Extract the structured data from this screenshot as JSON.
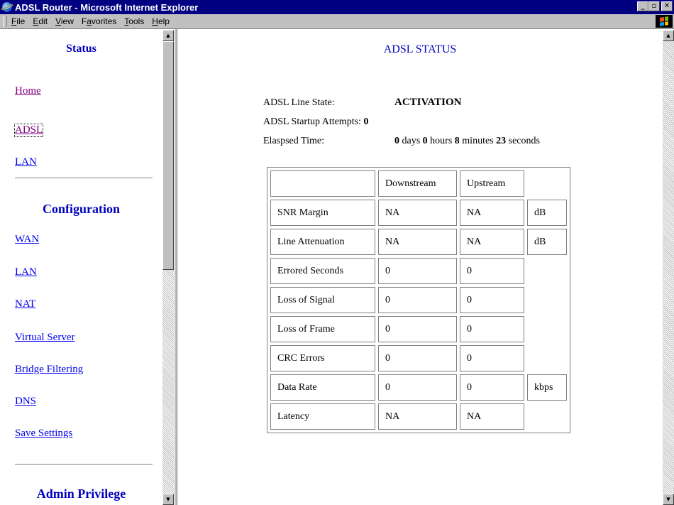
{
  "window": {
    "title": "ADSL Router - Microsoft Internet Explorer",
    "controls": [
      "_",
      "▫",
      "✕"
    ]
  },
  "menu": {
    "items": [
      {
        "label": "File",
        "key": "F"
      },
      {
        "label": "Edit",
        "key": "E"
      },
      {
        "label": "View",
        "key": "V"
      },
      {
        "label": "Favorites",
        "key": "a"
      },
      {
        "label": "Tools",
        "key": "T"
      },
      {
        "label": "Help",
        "key": "H"
      }
    ],
    "throbber_icon": "windows-logo-icon"
  },
  "sidebar": {
    "status_heading": "Status",
    "status_links": [
      "Home",
      "ADSL",
      "LAN"
    ],
    "config_heading": "Configuration",
    "config_links": [
      "WAN",
      "LAN",
      "NAT",
      "Virtual Server",
      "Bridge Filtering",
      "DNS",
      "Save Settings"
    ],
    "admin_heading": "Admin Privilege"
  },
  "main": {
    "title": "ADSL STATUS",
    "line_state_label": "ADSL Line State:",
    "line_state_value": "ACTIVATION",
    "startup_label": "ADSL Startup Attempts:",
    "startup_value": "0",
    "elapsed_label": "Elaspsed Time:",
    "elapsed": {
      "days": "0",
      "days_unit": "days",
      "hours": "0",
      "hours_unit": "hours",
      "minutes": "8",
      "minutes_unit": "minutes",
      "seconds": "23",
      "seconds_unit": "seconds"
    },
    "table": {
      "headers": [
        "",
        "Downstream",
        "Upstream"
      ],
      "rows": [
        {
          "label": "SNR Margin",
          "down": "NA",
          "up": "NA",
          "unit": "dB"
        },
        {
          "label": "Line Attenuation",
          "down": "NA",
          "up": "NA",
          "unit": "dB"
        },
        {
          "label": "Errored Seconds",
          "down": "0",
          "up": "0",
          "unit": ""
        },
        {
          "label": "Loss of Signal",
          "down": "0",
          "up": "0",
          "unit": ""
        },
        {
          "label": "Loss of Frame",
          "down": "0",
          "up": "0",
          "unit": ""
        },
        {
          "label": "CRC Errors",
          "down": "0",
          "up": "0",
          "unit": ""
        },
        {
          "label": "Data Rate",
          "down": "0",
          "up": "0",
          "unit": "kbps"
        },
        {
          "label": "Latency",
          "down": "NA",
          "up": "NA",
          "unit": ""
        }
      ]
    }
  }
}
